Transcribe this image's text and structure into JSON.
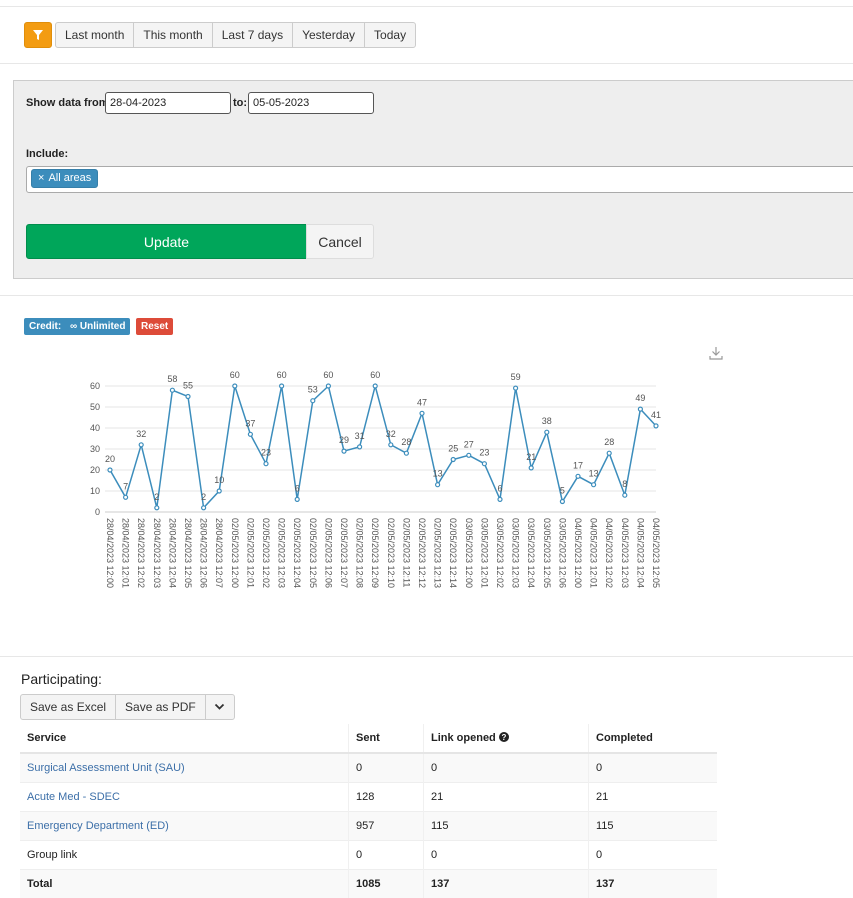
{
  "quick_filters": [
    "Last month",
    "This month",
    "Last 7 days",
    "Yesterday",
    "Today"
  ],
  "form": {
    "show_from_label": "Show data from:",
    "from_value": "28-04-2023",
    "to_label": "to:",
    "to_value": "05-05-2023",
    "include_label": "Include:",
    "include_tag": "All areas",
    "update_label": "Update",
    "cancel_label": "Cancel"
  },
  "badges": {
    "credit_label": "Credit:",
    "credit_value": "∞ Unlimited",
    "reset_label": "Reset"
  },
  "colors": {
    "accent": "#f39c12",
    "primary": "#3c8dbc",
    "success": "#00a65a",
    "danger": "#dd4b39",
    "line": "#3c8dbc"
  },
  "chart_data": {
    "type": "line",
    "ylim": [
      0,
      60
    ],
    "yticks": [
      0,
      10,
      20,
      30,
      40,
      50,
      60
    ],
    "grid": true,
    "categories": [
      "28/04/2023 12:00",
      "28/04/2023 12:01",
      "28/04/2023 12:02",
      "28/04/2023 12:03",
      "28/04/2023 12:04",
      "28/04/2023 12:05",
      "28/04/2023 12:06",
      "28/04/2023 12:07",
      "02/05/2023 12:00",
      "02/05/2023 12:01",
      "02/05/2023 12:02",
      "02/05/2023 12:03",
      "02/05/2023 12:04",
      "02/05/2023 12:05",
      "02/05/2023 12:06",
      "02/05/2023 12:07",
      "02/05/2023 12:08",
      "02/05/2023 12:09",
      "02/05/2023 12:10",
      "02/05/2023 12:11",
      "02/05/2023 12:12",
      "02/05/2023 12:13",
      "02/05/2023 12:14",
      "03/05/2023 12:00",
      "03/05/2023 12:01",
      "03/05/2023 12:02",
      "03/05/2023 12:03",
      "03/05/2023 12:04",
      "03/05/2023 12:05",
      "03/05/2023 12:06",
      "04/05/2023 12:00",
      "04/05/2023 12:01",
      "04/05/2023 12:02",
      "04/05/2023 12:03",
      "04/05/2023 12:04",
      "04/05/2023 12:05"
    ],
    "values": [
      20,
      7,
      32,
      2,
      58,
      55,
      2,
      10,
      60,
      37,
      23,
      60,
      6,
      53,
      60,
      29,
      31,
      60,
      32,
      28,
      47,
      13,
      25,
      27,
      23,
      6,
      59,
      21,
      38,
      5,
      17,
      13,
      28,
      8,
      49,
      41
    ]
  },
  "participating": {
    "title": "Participating:",
    "save_excel": "Save as Excel",
    "save_pdf": "Save as PDF",
    "columns": [
      "Service",
      "Sent",
      "Link opened",
      "Completed"
    ],
    "rows": [
      {
        "service": "Surgical Assessment Unit (SAU)",
        "sent": "0",
        "opened": "0",
        "completed": "0",
        "link": true
      },
      {
        "service": "Acute Med - SDEC",
        "sent": "128",
        "opened": "21",
        "completed": "21",
        "link": true
      },
      {
        "service": "Emergency Department (ED)",
        "sent": "957",
        "opened": "115",
        "completed": "115",
        "link": true
      },
      {
        "service": "Group link",
        "sent": "0",
        "opened": "0",
        "completed": "0",
        "link": false
      }
    ],
    "total": {
      "service": "Total",
      "sent": "1085",
      "opened": "137",
      "completed": "137"
    }
  }
}
